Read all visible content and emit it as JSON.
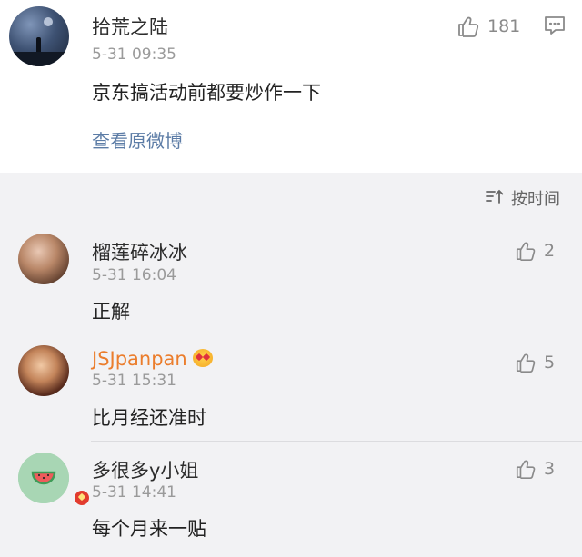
{
  "post": {
    "author": "拾荒之陆",
    "time": "5-31 09:35",
    "content": "京东搞活动前都要炒作一下",
    "likes": "181",
    "view_original": "查看原微博",
    "icons": {
      "like": "thumbs-up-icon",
      "comment": "comment-icon"
    }
  },
  "sort": {
    "label": "按时间",
    "icon": "sort-icon"
  },
  "comments": [
    {
      "author": "榴莲碎冰冰",
      "time": "5-31 16:04",
      "text": "正解",
      "likes": "2"
    },
    {
      "author": "JSJpanpan",
      "time": "5-31 15:31",
      "text": "比月经还准时",
      "likes": "5",
      "author_color": "#eb7d2c"
    },
    {
      "author": "多很多y小姐",
      "time": "5-31 14:41",
      "text": "每个月来一贴",
      "likes": "3"
    }
  ],
  "colors": {
    "link": "#5c7ca6",
    "vip_name": "#eb7d2c",
    "background": "#f2f2f4",
    "card": "#ffffff"
  }
}
